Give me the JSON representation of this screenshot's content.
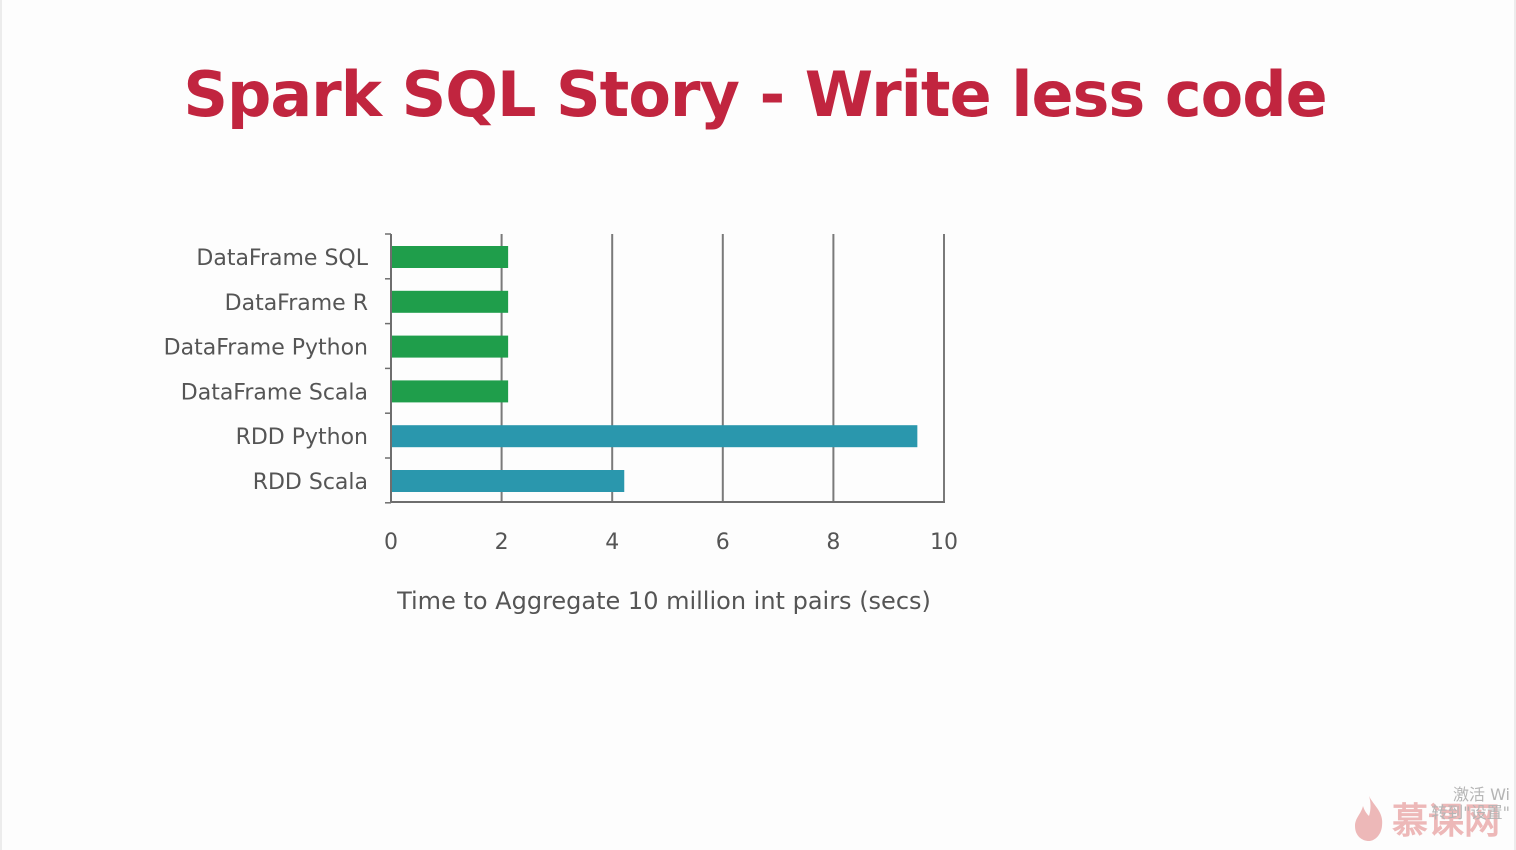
{
  "slide": {
    "title": "Spark SQL Story - Write less code"
  },
  "chart_data": {
    "type": "bar",
    "orientation": "horizontal",
    "categories": [
      "DataFrame SQL",
      "DataFrame R",
      "DataFrame Python",
      "DataFrame Scala",
      "RDD Python",
      "RDD Scala"
    ],
    "values": [
      2.1,
      2.1,
      2.1,
      2.1,
      9.5,
      4.2
    ],
    "bar_colors": [
      "#1f9e4b",
      "#1f9e4b",
      "#1f9e4b",
      "#1f9e4b",
      "#2a97ad",
      "#2a97ad"
    ],
    "xticks": [
      0,
      2,
      4,
      6,
      8,
      10
    ],
    "xlim": [
      0,
      10
    ],
    "xlabel": "Time to Aggregate 10 million int pairs (secs)",
    "ylabel": "",
    "title": "",
    "grid": "vertical",
    "legend": "none"
  },
  "watermark": {
    "text": "慕课网",
    "icon": "flame-icon",
    "color": "#d23a3a"
  },
  "system_overlay": {
    "line1": "激活 Wi",
    "line2": "转到\"设置\""
  }
}
